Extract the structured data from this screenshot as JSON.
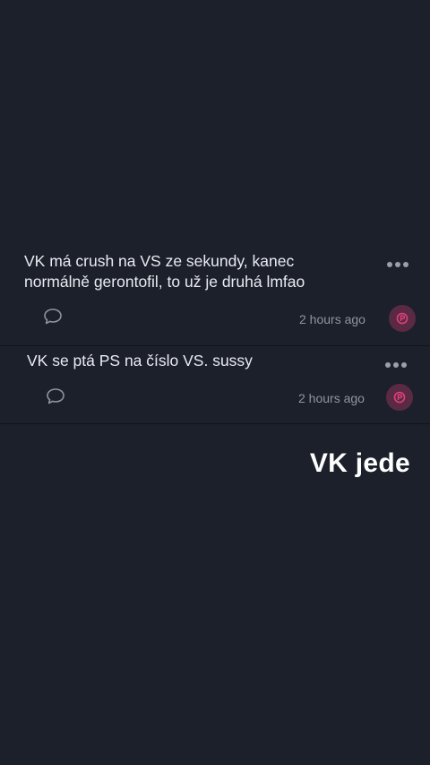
{
  "posts": [
    {
      "text": "VK má crush na VS ze sekundy, kanec\nnormálně gerontofil, to už je druhá lmfao",
      "time": "2 hours ago"
    },
    {
      "text": "VK se ptá PS na číslo VS. sussy",
      "time": "2 hours ago"
    }
  ],
  "icons": {
    "more": "more-horizontal-icon",
    "comment": "comment-bubble-icon",
    "avatar": "avatar-badge-icon"
  },
  "colors": {
    "background": "#1b202b",
    "avatar_bg": "#5a2a44",
    "avatar_accent": "#e0407a",
    "muted_text": "#8f95a0"
  },
  "overlay": {
    "caption": "VK jede"
  }
}
